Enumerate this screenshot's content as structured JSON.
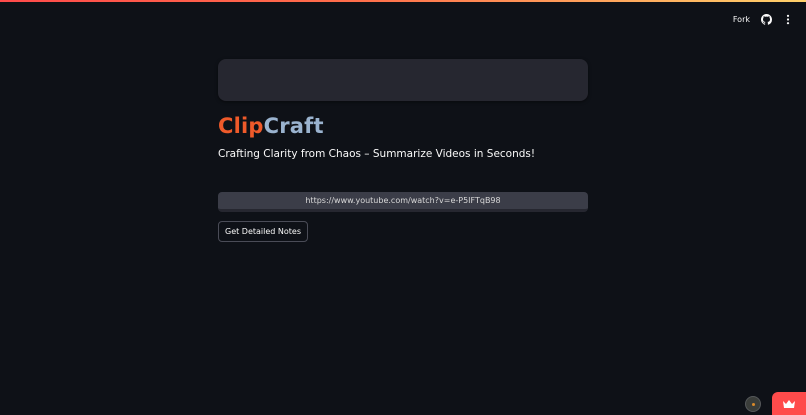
{
  "header": {
    "fork_label": "Fork",
    "github_icon": "github-icon",
    "menu_icon": "kebab-menu-icon"
  },
  "app": {
    "title_part1": "Clip",
    "title_part2": "Craft",
    "subtitle": "Crafting Clarity from Chaos – Summarize Videos in Seconds!"
  },
  "form": {
    "url_value": "https://www.youtube.com/watch?v=e-P5IFTqB98",
    "submit_label": "Get Detailed Notes"
  },
  "colors": {
    "background": "#0e1117",
    "title_accent": "#ef5a2a",
    "title_secondary": "#9ab3cf",
    "brand_red": "#ff4b4b"
  },
  "footer": {
    "status_icon": "status-indicator-icon",
    "crown_icon": "crown-icon"
  }
}
